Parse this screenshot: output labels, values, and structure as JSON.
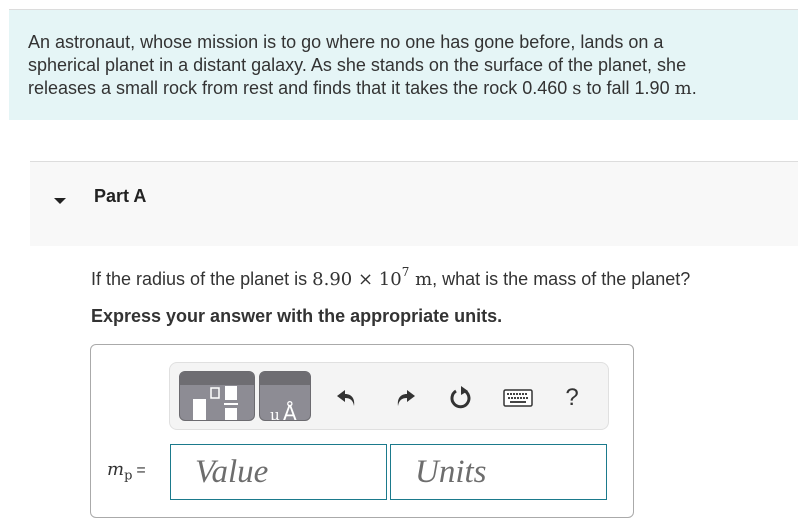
{
  "intro": {
    "line1": "An astronaut, whose mission is to go where no one has gone before, lands on a",
    "line2": "spherical planet in a distant galaxy. As she stands on the surface of the planet, she",
    "line3_pre": "releases a small rock from rest and finds that it takes the rock ",
    "time_value": "0.460",
    "time_unit": "s",
    "line3_mid": " to fall ",
    "distance_value": "1.90",
    "distance_unit": "m",
    "line3_end": "."
  },
  "part": {
    "title": "Part A",
    "toggle_icon": "caret-down-icon",
    "expanded": true
  },
  "question": {
    "pre": "If the radius of the planet is ",
    "radius_mantissa": "8.90",
    "times": "×",
    "radius_base": "10",
    "radius_exponent": "7",
    "radius_unit": "m",
    "post": ", what is the mass of the planet?"
  },
  "instruction": "Express your answer with the appropriate units.",
  "answer": {
    "variable": "m",
    "subscript": "p",
    "equals": "=",
    "value_placeholder": "Value",
    "units_placeholder": "Units",
    "value": "",
    "units": ""
  },
  "toolbar": {
    "buttons": [
      {
        "name": "templates-button",
        "icon": "fraction-template-icon"
      },
      {
        "name": "units-template-button",
        "icon": "units-template-icon",
        "label": "μÅ"
      },
      {
        "name": "undo-button",
        "icon": "undo-icon"
      },
      {
        "name": "redo-button",
        "icon": "redo-icon"
      },
      {
        "name": "reset-button",
        "icon": "reset-icon"
      },
      {
        "name": "keyboard-shortcuts-button",
        "icon": "keyboard-icon"
      },
      {
        "name": "help-button",
        "icon": "help-icon",
        "label": "?"
      }
    ]
  },
  "colors": {
    "intro_bg": "#e5f5f6",
    "part_header_bg": "#f8f8f8",
    "input_border": "#1b7a8c",
    "template_btn": "#8d8c94"
  }
}
